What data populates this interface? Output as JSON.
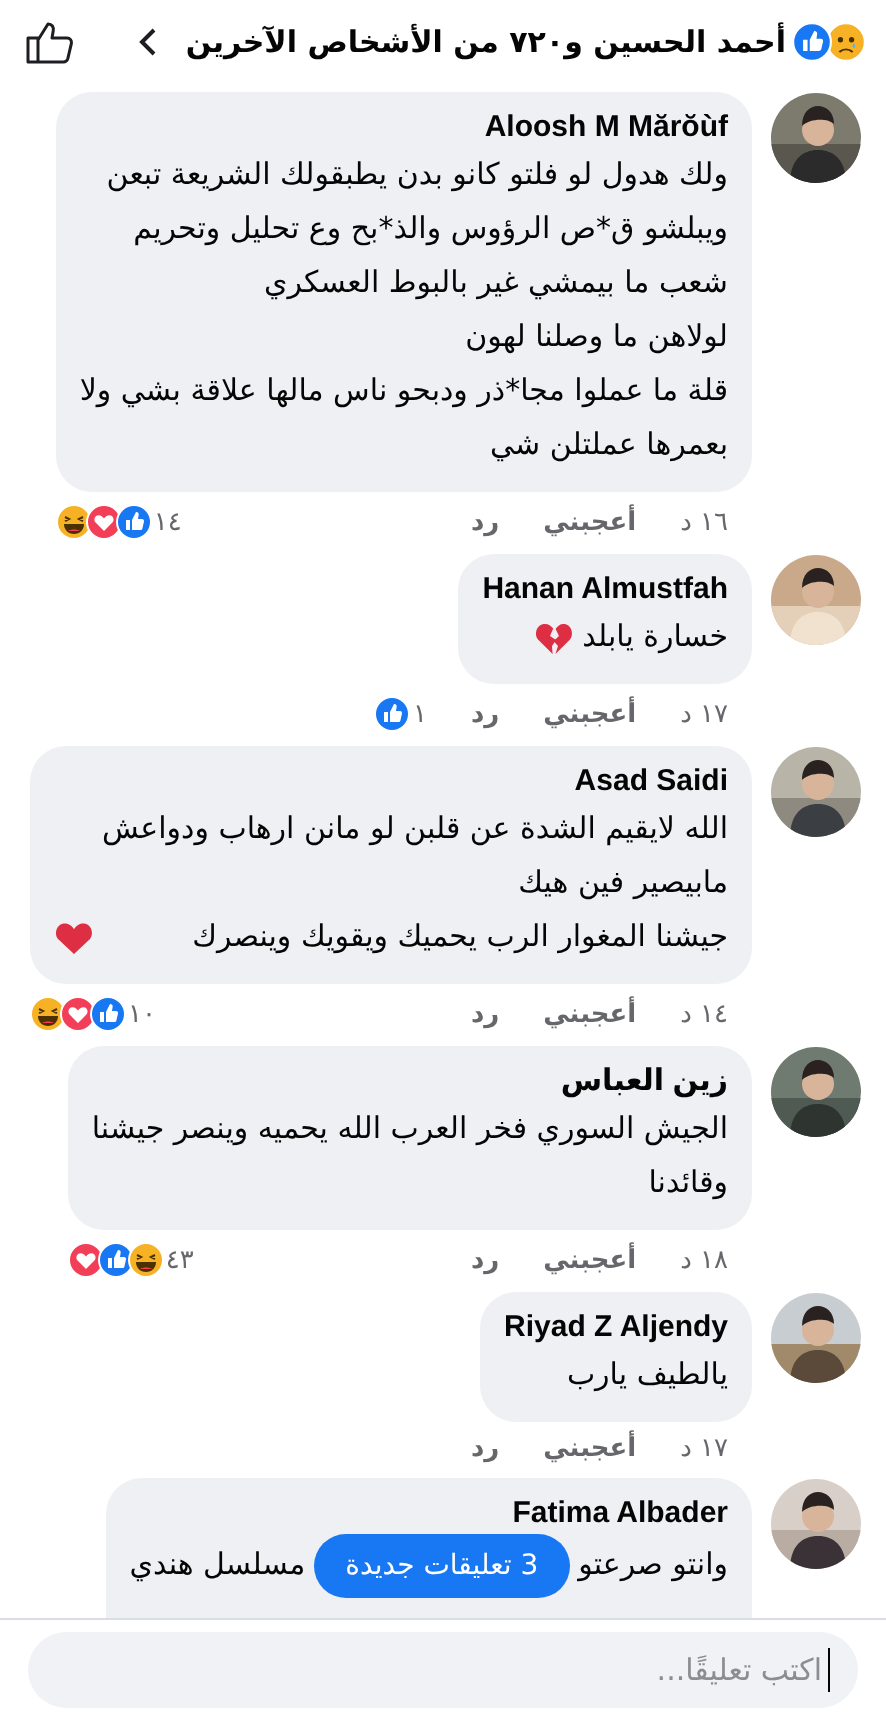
{
  "header": {
    "reactions": [
      {
        "kind": "like"
      },
      {
        "kind": "sad"
      }
    ],
    "text": "أحمد الحسين و٧٢٠ من الأشخاص الآخرين"
  },
  "comments": [
    {
      "name": "Aloosh M Mărŏùf",
      "text": "ولك هدول لو فلتو كانو بدن يطبقولك الشريعة تبعن\nويبلشو ق*ص الرؤوس والذ*بح وع تحليل وتحريم\nشعب ما بيمشي غير بالبوط العسكري\nلولاهن ما وصلنا لهون\nقلة ما عملوا مجا*ذر ودبحو ناس مالها علاقة بشي ولا\nبعمرها عملتلن شي",
      "time": "١٦ د",
      "like": "أعجبني",
      "reply": "رد",
      "reactions": [
        {
          "kind": "haha"
        },
        {
          "kind": "love"
        },
        {
          "kind": "like"
        }
      ],
      "count": "١٤"
    },
    {
      "name": "Hanan Almustfah",
      "text": "خسارة يابلد",
      "emoji": {
        "kind": "broken_heart"
      },
      "time": "١٧ د",
      "like": "أعجبني",
      "reply": "رد",
      "reactions": [
        {
          "kind": "like"
        }
      ],
      "count": "١"
    },
    {
      "name": "Asad Saidi",
      "text": "الله لايقيم الشدة عن قلبن لو مانن ارهاب ودواعش\nمابيصير فين هيك\nجيشنا المغوار الرب يحميك ويقويك وينصرك",
      "emoji": {
        "kind": "red_heart"
      },
      "time": "١٤ د",
      "like": "أعجبني",
      "reply": "رد",
      "reactions": [
        {
          "kind": "haha"
        },
        {
          "kind": "love"
        },
        {
          "kind": "like"
        }
      ],
      "count": "١٠"
    },
    {
      "name": "زين العباس",
      "text": "الجيش السوري فخر العرب الله يحميه وينصر جيشنا\nوقائدنا",
      "time": "١٨ د",
      "like": "أعجبني",
      "reply": "رد",
      "reactions": [
        {
          "kind": "love"
        },
        {
          "kind": "like"
        },
        {
          "kind": "haha"
        }
      ],
      "count": "٤٣"
    },
    {
      "name": "Riyad Z Aljendy",
      "text": "يالطيف يارب",
      "time": "١٧ د",
      "like": "أعجبني",
      "reply": "رد"
    },
    {
      "name": "Fatima Albader",
      "text_start": "وانتو صرعتو",
      "text_end": "مسلسل هندي"
    }
  ],
  "new_comments": "3 تعليقات جديدة",
  "composer": {
    "placeholder": "اكتب تعليقًا..."
  }
}
